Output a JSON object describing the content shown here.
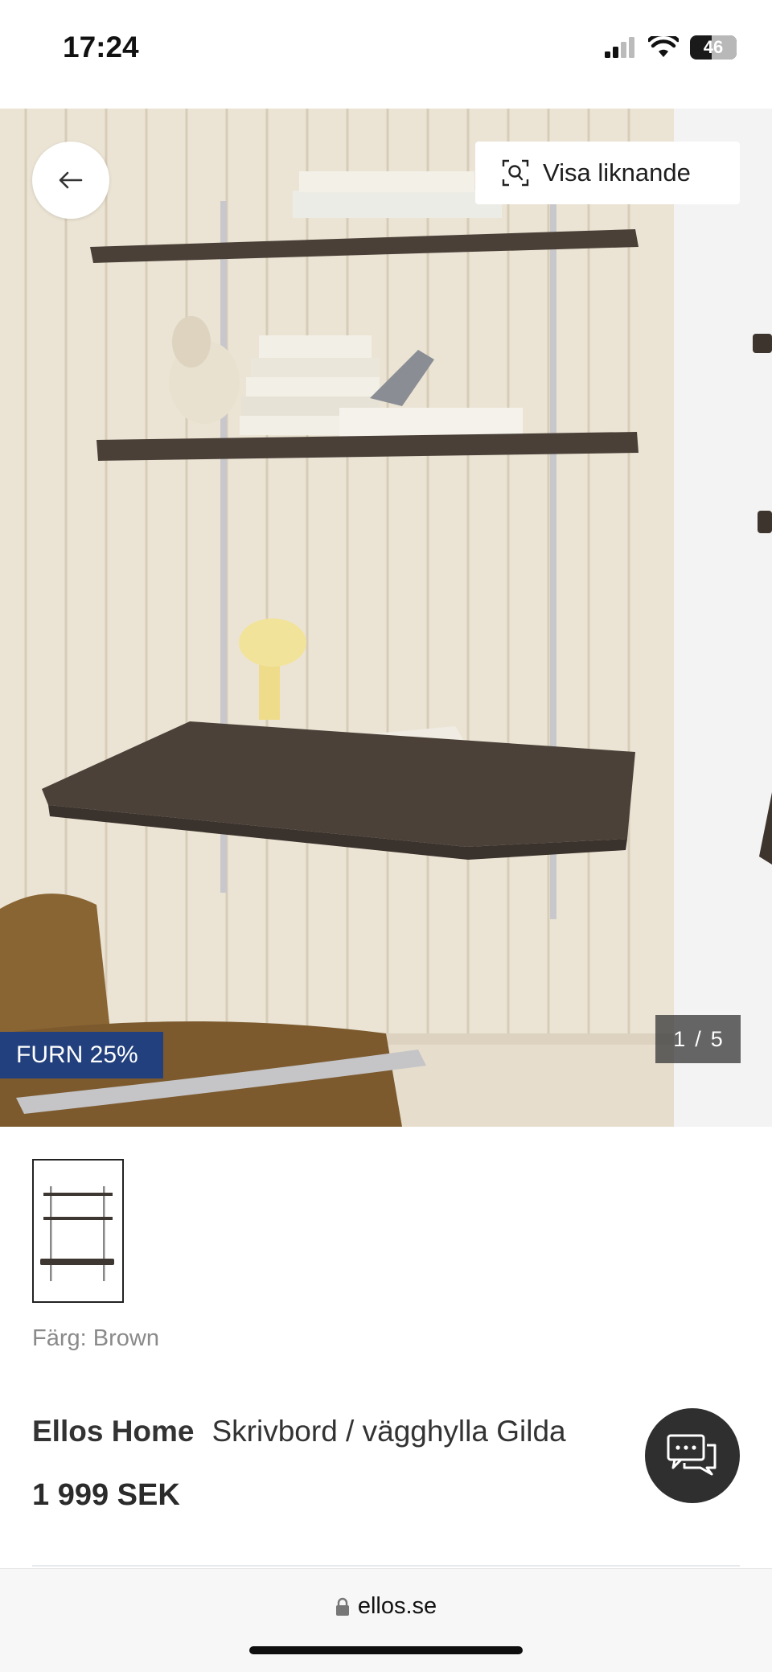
{
  "status_bar": {
    "time": "17:24",
    "battery": "46"
  },
  "gallery": {
    "similar_label": "Visa liknande",
    "badge": "FURN 25%",
    "page_current": "1",
    "page_separator": "/",
    "page_total": "5"
  },
  "product": {
    "color_label": "Färg: Brown",
    "brand": "Ellos Home",
    "name": "Skrivbord / vägghylla Gilda",
    "price": "1 999 SEK"
  },
  "browser": {
    "url": "ellos.se"
  },
  "icons": {
    "back": "arrow-left-icon",
    "similar": "visual-search-icon",
    "chat": "chat-bubbles-icon",
    "lock": "lock-icon"
  },
  "colors": {
    "badge_bg": "#22407e",
    "chat_bg": "#2f2f2f",
    "counter_bg": "#3c3c3c"
  }
}
